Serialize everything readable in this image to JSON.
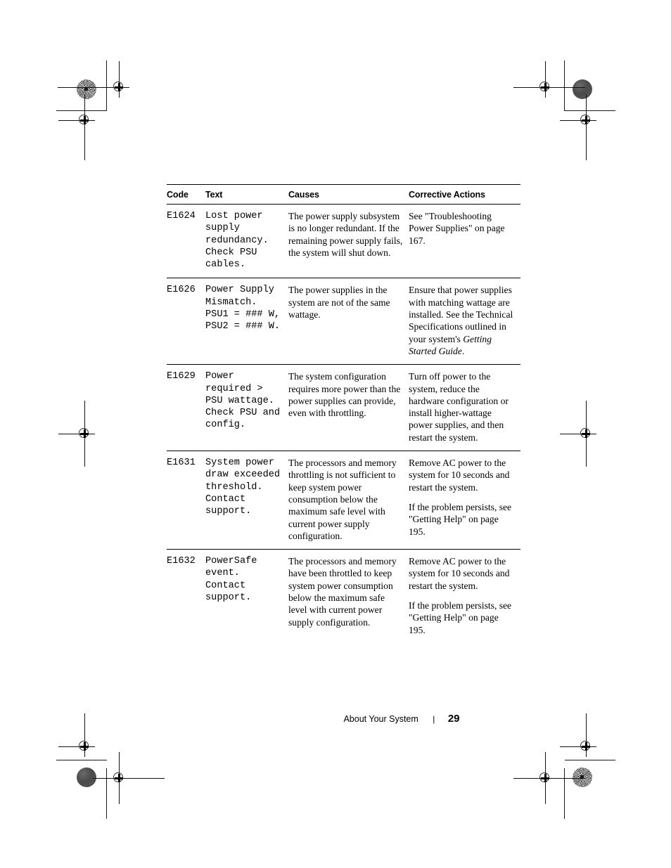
{
  "document": {
    "footer": {
      "chapter": "About Your System",
      "separator": "|",
      "page_number": "29"
    }
  },
  "table": {
    "headers": {
      "code": "Code",
      "text": "Text",
      "causes": "Causes",
      "corrective_actions": "Corrective Actions"
    },
    "rows": [
      {
        "code": "E1624",
        "text": "Lost power\nsupply\nredundancy.\nCheck PSU\ncables.",
        "cause": "The power supply subsystem is no longer redundant. If the remaining power supply fails, the system will shut down.",
        "action_paragraphs": [
          "See \"Troubleshooting Power Supplies\" on page 167."
        ]
      },
      {
        "code": "E1626",
        "text": "Power Supply\nMismatch.\nPSU1 = ### W,\nPSU2 = ### W.",
        "cause": "The power supplies in the system are not of the same wattage.",
        "action_paragraphs": [
          "Ensure that power supplies with matching wattage are installed. See the Technical Specifications outlined in your system's Getting Started Guide."
        ],
        "action_italic_phrase": "Getting Started Guide"
      },
      {
        "code": "E1629",
        "text": "Power\nrequired >\nPSU wattage.\nCheck PSU and\nconfig.",
        "cause": "The system configuration requires more power than the power supplies can provide, even with throttling.",
        "action_paragraphs": [
          "Turn off power to the system, reduce the hardware configuration or install higher-wattage power supplies, and then restart the system."
        ]
      },
      {
        "code": "E1631",
        "text": "System power\ndraw exceeded\nthreshold.\nContact\nsupport.",
        "cause": "The processors and memory throttling is not sufficient to keep system power consumption below the maximum safe level with current power supply configuration.",
        "action_paragraphs": [
          "Remove AC power to the system for 10 seconds and restart the system.",
          "If the problem persists, see \"Getting Help\" on page 195."
        ]
      },
      {
        "code": "E1632",
        "text": "PowerSafe\nevent.\nContact\nsupport.",
        "cause": "The processors and memory have been throttled to keep system power consumption below the maximum safe level with current power supply configuration.",
        "action_paragraphs": [
          "Remove AC power to the system for 10 seconds and restart the system.",
          "If the problem persists, see \"Getting Help\" on page 195."
        ]
      }
    ]
  },
  "print_marks": {
    "description": "registration targets and halftone density patches"
  }
}
